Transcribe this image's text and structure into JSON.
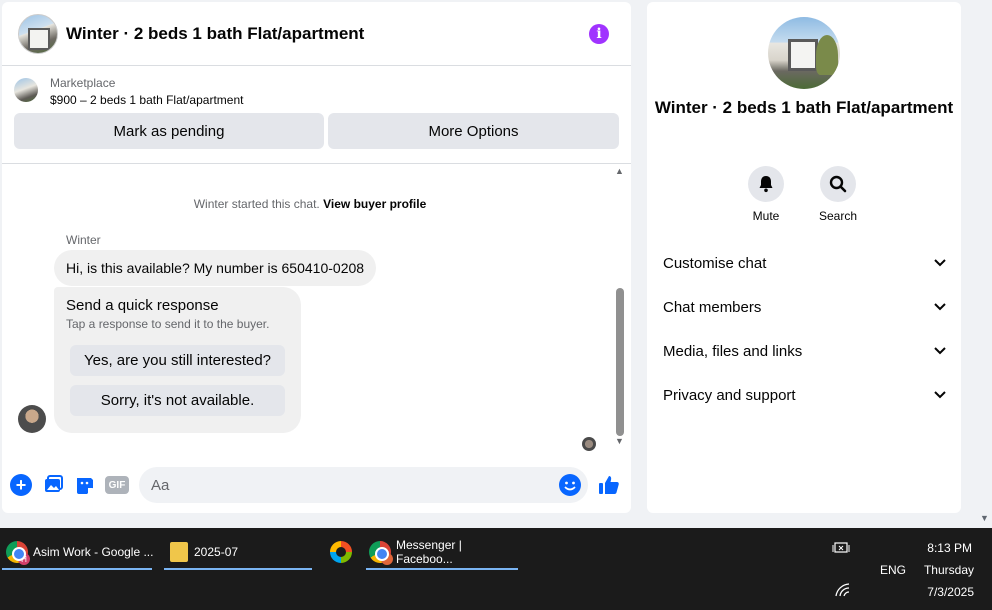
{
  "chat": {
    "title": "Winter · 2 beds 1 bath Flat/apartment",
    "marketplace": {
      "source": "Marketplace",
      "price_title": "$900 – 2 beds 1 bath Flat/apartment",
      "pending_label": "Mark as pending",
      "more_label": "More Options"
    },
    "system_message": {
      "text": "Winter started this chat. ",
      "link": "View buyer profile"
    },
    "message": {
      "sender": "Winter",
      "text": "Hi, is this available?  My number is 650410-0208"
    },
    "quick_response": {
      "title": "Send a quick response",
      "subtitle": "Tap a response to send it to the buyer.",
      "options": [
        "Yes, are you still interested?",
        "Sorry, it's not available."
      ]
    },
    "composer": {
      "placeholder": "Aa",
      "gif_label": "GIF"
    }
  },
  "info_panel": {
    "name": "Winter · 2 beds 1 bath Flat/apartment",
    "actions": [
      {
        "label": "Mute",
        "icon": "bell-icon"
      },
      {
        "label": "Search",
        "icon": "search-icon"
      }
    ],
    "sections": [
      "Customise chat",
      "Chat members",
      "Media, files and links",
      "Privacy and support"
    ]
  },
  "taskbar": {
    "tasks": [
      {
        "label": "Asim Work - Google ...",
        "icon": "chrome-icon",
        "badge": "H"
      },
      {
        "label": "2025-07",
        "icon": "folder-icon"
      },
      {
        "label": "",
        "icon": "copilot-icon"
      },
      {
        "label": "Messenger | Faceboo...",
        "icon": "chrome-icon"
      }
    ],
    "language": "ENG",
    "time": "8:13 PM",
    "day": "Thursday",
    "date": "7/3/2025"
  },
  "colors": {
    "accent_blue": "#0866ff",
    "info_purple": "#a033ff",
    "panel_bg": "#f0f2f5",
    "taskbar_bg": "#1b1b1b"
  }
}
